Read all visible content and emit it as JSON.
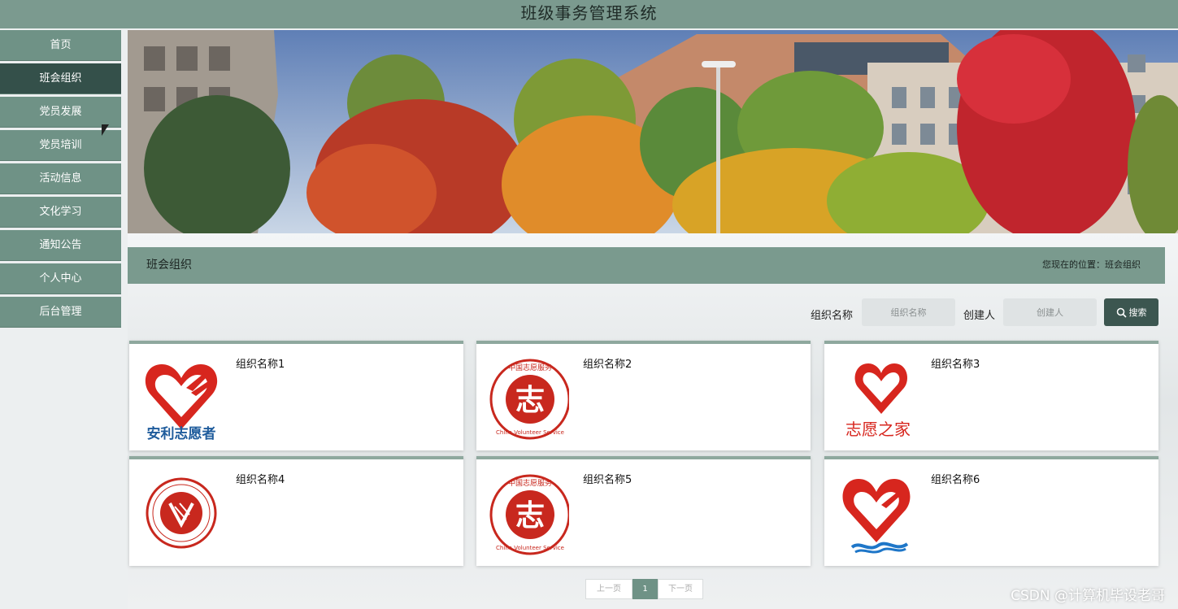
{
  "app": {
    "title": "班级事务管理系统"
  },
  "nav": {
    "items": [
      {
        "label": "首页"
      },
      {
        "label": "班会组织"
      },
      {
        "label": "党员发展"
      },
      {
        "label": "党员培训"
      },
      {
        "label": "活动信息"
      },
      {
        "label": "文化学习"
      },
      {
        "label": "通知公告"
      },
      {
        "label": "个人中心"
      },
      {
        "label": "后台管理"
      }
    ],
    "active_index": 1
  },
  "section": {
    "title": "班会组织",
    "location": "您现在的位置：班会组织"
  },
  "search": {
    "org_label": "组织名称",
    "org_placeholder": "组织名称",
    "creator_label": "创建人",
    "creator_placeholder": "创建人",
    "button_label": "搜索"
  },
  "cards": [
    {
      "name": "组织名称1",
      "logo": "heart-hand-logo",
      "logo_caption": "安利志愿者"
    },
    {
      "name": "组织名称2",
      "logo": "china-volunteer-service-seal",
      "seal_top": "中国志愿服务",
      "seal_bottom": "China Volunteer Service",
      "seal_char": "志"
    },
    {
      "name": "组织名称3",
      "logo": "heart-hand-logo",
      "logo_caption": "志愿之家"
    },
    {
      "name": "组织名称4",
      "logo": "youth-volunteer-association-seal"
    },
    {
      "name": "组织名称5",
      "logo": "china-volunteer-service-seal",
      "seal_top": "中国志愿服务",
      "seal_bottom": "China Volunteer Service",
      "seal_char": "志"
    },
    {
      "name": "组织名称6",
      "logo": "heart-hand-wave-logo"
    }
  ],
  "pagination": {
    "prev": "上一页",
    "current": "1",
    "next": "下一页"
  },
  "watermark": "CSDN @计算机毕设老哥",
  "colors": {
    "topbar": "#7b9a8f",
    "nav": "#6f9286",
    "nav_active": "#34504a",
    "accent_red": "#d7261e"
  }
}
